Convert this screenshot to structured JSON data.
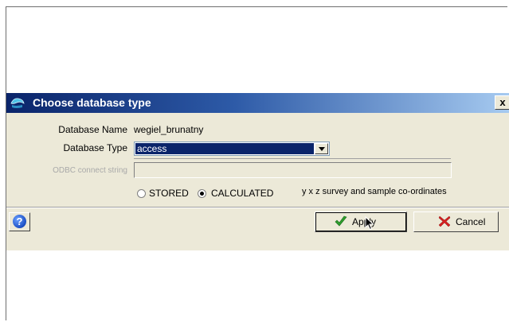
{
  "dialog": {
    "title": "Choose database type",
    "close_label": "x"
  },
  "form": {
    "db_name_label": "Database Name",
    "db_name_value": "wegiel_brunatny",
    "db_type_label": "Database Type",
    "db_type_value": "access",
    "odbc_label": "ODBC connect string",
    "odbc_value": "",
    "radio_stored_label": "STORED",
    "radio_calculated_label": "CALCULATED",
    "radio_selected": "CALCULATED",
    "coords_text": "y x z survey and sample co-ordinates"
  },
  "footer": {
    "help_label": "?",
    "apply_label": "Apply",
    "cancel_label": "Cancel"
  },
  "icons": {
    "title": "database-icon",
    "apply": "checkmark-icon",
    "cancel": "x-icon",
    "help": "help-icon"
  },
  "colors": {
    "titlebar_start": "#0a246a",
    "titlebar_end": "#a6caf0",
    "dialog_bg": "#ece9d8",
    "selection": "#0a246a",
    "apply_check": "#2e9e2e",
    "cancel_x": "#d42020"
  }
}
